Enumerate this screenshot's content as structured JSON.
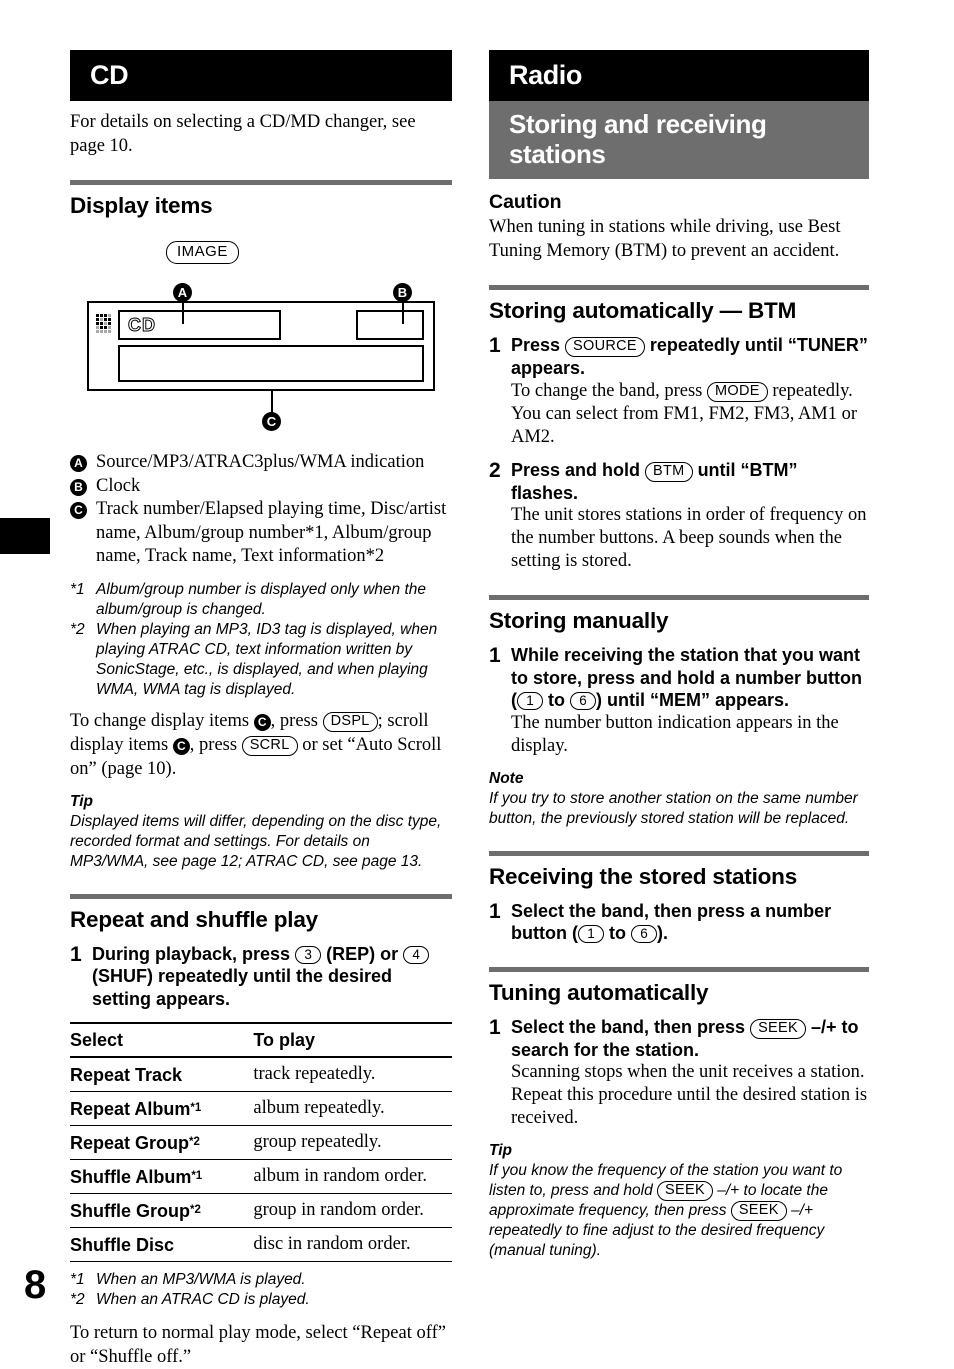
{
  "page": {
    "number": "8"
  },
  "left": {
    "banner": "CD",
    "intro": "For details on selecting a CD/MD changer, see page 10.",
    "display_items": {
      "heading": "Display items",
      "image_caption": "IMAGE",
      "lcd_source_text": "CD",
      "marker_a": "A",
      "marker_b": "B",
      "marker_c": "C",
      "legend": [
        {
          "badge": "A",
          "text": "Source/MP3/ATRAC3plus/WMA indication"
        },
        {
          "badge": "B",
          "text": "Clock"
        },
        {
          "badge": "C",
          "text": "Track number/Elapsed playing time, Disc/artist name, Album/group number*1, Album/group name, Track name, Text information*2"
        }
      ],
      "footnotes": [
        {
          "mark": "*1",
          "text": "Album/group number is displayed only when the album/group is changed."
        },
        {
          "mark": "*2",
          "text": "When playing an MP3, ID3 tag is displayed, when playing ATRAC CD, text information written by SonicStage, etc., is displayed, and when playing WMA, WMA tag is displayed."
        }
      ],
      "change_text_1": "To change display items ",
      "change_text_2": ", press ",
      "key_dspl": "DSPL",
      "change_text_3": "; scroll display items ",
      "change_text_4": ", press ",
      "key_scrl": "SCRL",
      "change_text_5": " or set “Auto Scroll on” (page 10).",
      "tip_head": "Tip",
      "tip_text": "Displayed items will differ, depending on the disc type, recorded format and settings. For details on MP3/WMA, see page 12; ATRAC CD, see page 13."
    },
    "repeat_shuffle": {
      "heading": "Repeat and shuffle play",
      "step_number": "1",
      "step_text_1": "During playback, press ",
      "key_3": "3",
      "step_text_2": " (REP) or ",
      "key_4": "4",
      "step_text_3": " (SHUF) repeatedly until the desired setting appears.",
      "table": {
        "headers": [
          "Select",
          "To play"
        ],
        "rows": [
          {
            "select": "Repeat Track",
            "sup": "",
            "play": "track repeatedly."
          },
          {
            "select": "Repeat Album",
            "sup": "*1",
            "play": "album repeatedly."
          },
          {
            "select": "Repeat Group",
            "sup": "*2",
            "play": "group repeatedly."
          },
          {
            "select": "Shuffle Album",
            "sup": "*1",
            "play": "album in random order."
          },
          {
            "select": "Shuffle Group",
            "sup": "*2",
            "play": "group in random order."
          },
          {
            "select": "Shuffle Disc",
            "sup": "",
            "play": "disc in random order."
          }
        ]
      },
      "footnotes": [
        {
          "mark": "*1",
          "text": "When an MP3/WMA is played."
        },
        {
          "mark": "*2",
          "text": "When an ATRAC CD is played."
        }
      ],
      "closing": "To return to normal play mode, select “Repeat off” or “Shuffle off.”"
    }
  },
  "right": {
    "banner_black": "Radio",
    "banner_gray": "Storing and receiving stations",
    "caution": {
      "heading": "Caution",
      "text": "When tuning in stations while driving, use Best Tuning Memory (BTM) to prevent an accident."
    },
    "btm": {
      "heading": "Storing automatically — BTM",
      "step1_number": "1",
      "step1_text_1": "Press ",
      "key_source": "SOURCE",
      "step1_text_2": " repeatedly until “TUNER” appears.",
      "step1_detail_1": "To change the band, press ",
      "key_mode": "MODE",
      "step1_detail_2": " repeatedly. You can select from FM1, FM2, FM3, AM1 or AM2.",
      "step2_number": "2",
      "step2_text_1": "Press and hold ",
      "key_btm": "BTM",
      "step2_text_2": " until “BTM” flashes.",
      "step2_detail": "The unit stores stations in order of frequency on the number buttons. A beep sounds when the setting is stored."
    },
    "manual": {
      "heading": "Storing manually",
      "step_number": "1",
      "step_text_1": "While receiving the station that you want to store, press and hold a number button (",
      "key_1": "1",
      "step_text_2": " to ",
      "key_6": "6",
      "step_text_3": ") until “MEM” appears.",
      "step_detail": "The number button indication appears in the display.",
      "note_head": "Note",
      "note_text": "If you try to store another station on the same number button, the previously stored station will be replaced."
    },
    "receiving": {
      "heading": "Receiving the stored stations",
      "step_number": "1",
      "step_text_1": "Select the band, then press a number button (",
      "key_1": "1",
      "step_text_2": " to ",
      "key_6": "6",
      "step_text_3": ")."
    },
    "tuning": {
      "heading": "Tuning automatically",
      "step_number": "1",
      "step_text_1": "Select the band, then press ",
      "key_seek": "SEEK",
      "step_text_2": " –/+ to search for the station.",
      "step_detail": "Scanning stops when the unit receives a station. Repeat this procedure until the desired station is received.",
      "tip_head": "Tip",
      "tip_text_1": "If you know the frequency of the station you want to listen to, press and hold ",
      "tip_key_1": "SEEK",
      "tip_text_2": " –/+ to locate the approximate frequency, then press ",
      "tip_key_2": "SEEK",
      "tip_text_3": " –/+ repeatedly to fine adjust to the desired frequency (manual tuning)."
    }
  }
}
